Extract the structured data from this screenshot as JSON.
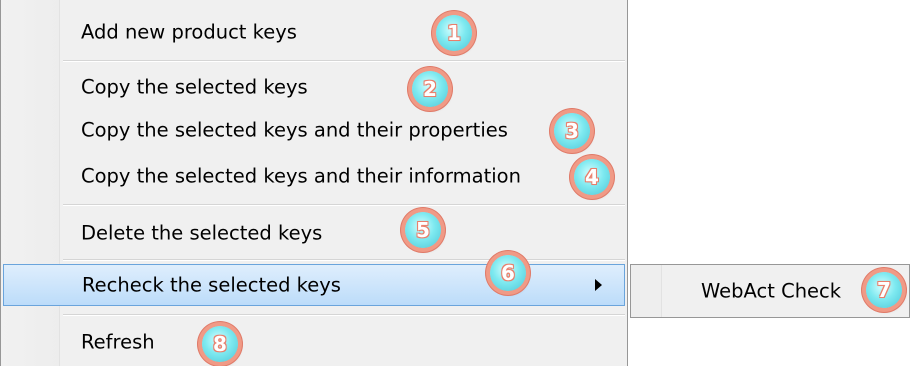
{
  "context_menu": {
    "items": [
      {
        "label": "Add new product keys",
        "badge": "1"
      },
      {
        "label": "Copy the selected keys",
        "badge": "2"
      },
      {
        "label": "Copy the selected keys and their properties",
        "badge": "3"
      },
      {
        "label": "Copy the selected keys and their information",
        "badge": "4"
      },
      {
        "label": "Delete the selected keys",
        "badge": "5"
      },
      {
        "label": "Recheck the selected keys",
        "badge": "6",
        "has_submenu": true,
        "highlighted": true
      },
      {
        "label": "Refresh",
        "badge": "8"
      }
    ]
  },
  "submenu": {
    "items": [
      {
        "label": "WebAct Check",
        "badge": "7"
      }
    ]
  },
  "colors": {
    "menu_background": "#f0f0f0",
    "highlight_background": "#cce4f9",
    "highlight_border": "#6aa4dc",
    "badge_fill": "#7ee9f0",
    "badge_ring": "#f09a86"
  }
}
